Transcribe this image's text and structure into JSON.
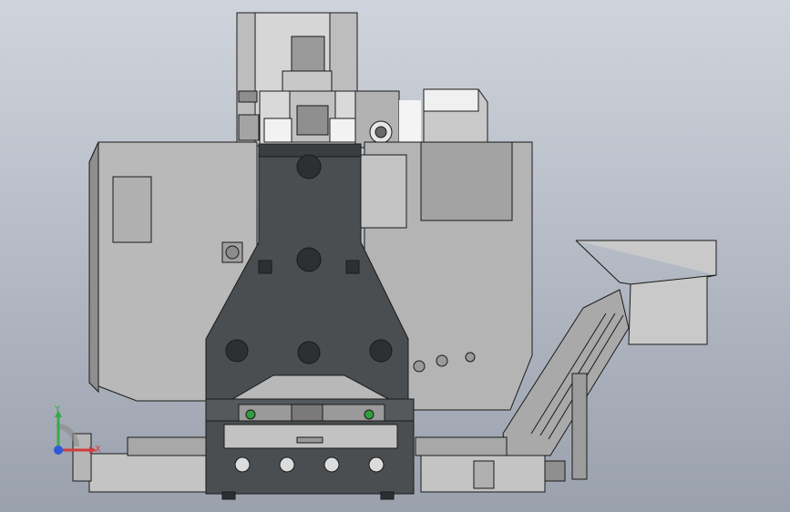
{
  "viewport": {
    "background_top": "#cfd4dc",
    "background_bottom": "#9aa1ad"
  },
  "colors": {
    "machine_light": "#b8b8b8",
    "machine_mid": "#a9a9a9",
    "machine_panel": "#c6c6c6",
    "column_dark": "#4a4e50",
    "column_shadow": "#3a3e40",
    "outline": "#1a1a1a",
    "hole": "#2d3032",
    "accent_green": "#2e9e3e"
  },
  "triad": {
    "y_label": "Y",
    "x_label": "X",
    "y_color": "#3aa94a",
    "x_color": "#d23c3c",
    "z_color": "#2d5ad8"
  }
}
